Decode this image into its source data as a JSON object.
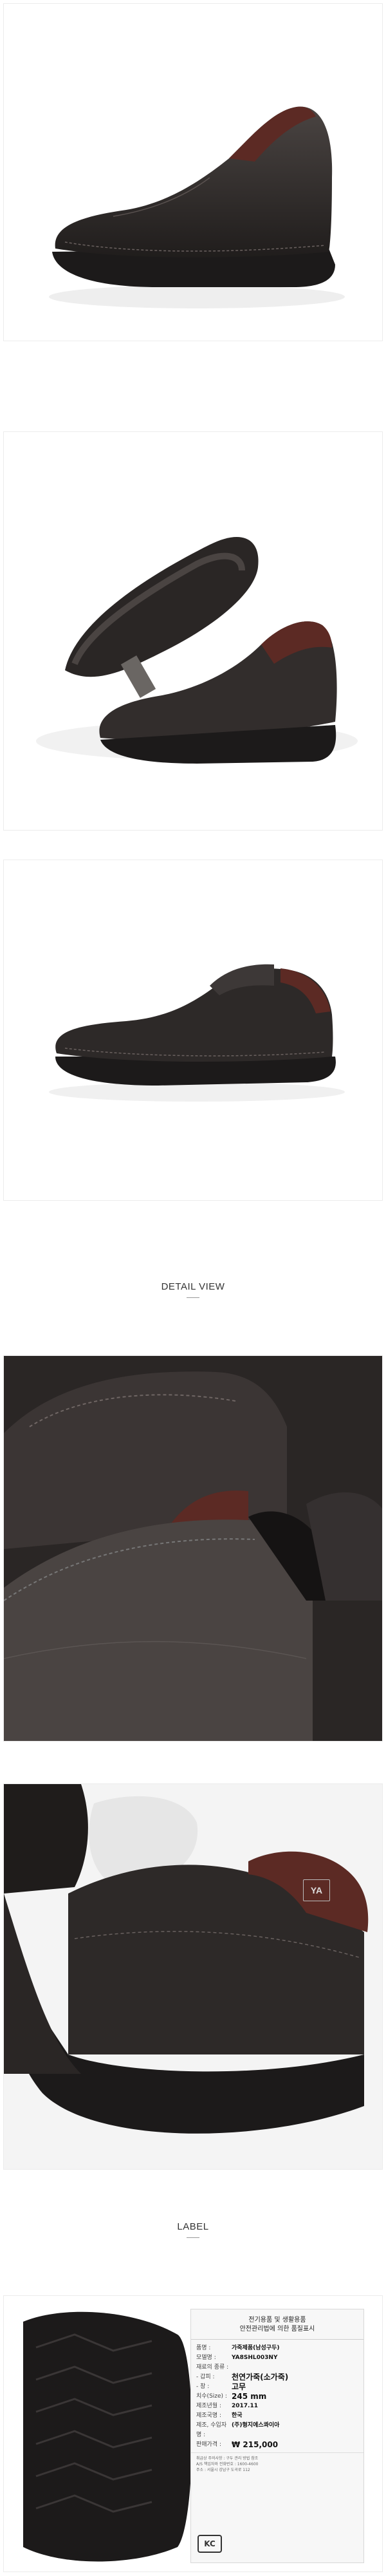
{
  "sections": {
    "detail_title": "DETAIL VIEW",
    "label_title": "LABEL"
  },
  "label": {
    "header_line1": "전기용품 및 생활용품",
    "header_line2": "안전관리법에 의한 품질표시",
    "rows": [
      {
        "k": "품명 :",
        "v": "가죽제품(남성구두)"
      },
      {
        "k": "모델명 :",
        "v": "YA8SHL003NY"
      },
      {
        "k": "재료의 종류 :",
        "v": ""
      },
      {
        "k": "- 갑피 :",
        "v": "천연가죽(소가죽)"
      },
      {
        "k": "- 창 :",
        "v": "고무"
      },
      {
        "k": "치수(Size) :",
        "v": "245 mm"
      },
      {
        "k": "제조년월 :",
        "v": "2017.11"
      },
      {
        "k": "제조국명 :",
        "v": "한국"
      },
      {
        "k": "제조, 수입자명 :",
        "v": "(주)형지에스콰이아"
      },
      {
        "k": "판매가격 :",
        "v": "₩ 215,000"
      }
    ],
    "notes": [
      "취급상 주의사항 : 구두 관리 방법 참조",
      "A/S 책임자와 전화번호 : 1600-4600",
      "주소 : 서울시 강남구 도곡로 112"
    ],
    "kc_mark": "KC"
  },
  "brand_tag": "YA",
  "colors": {
    "leather": "#2b2726",
    "leather_highlight": "#4a4442",
    "heel_burgundy": "#5c2a24",
    "sole": "#1c1a1a",
    "background": "#ffffff"
  }
}
